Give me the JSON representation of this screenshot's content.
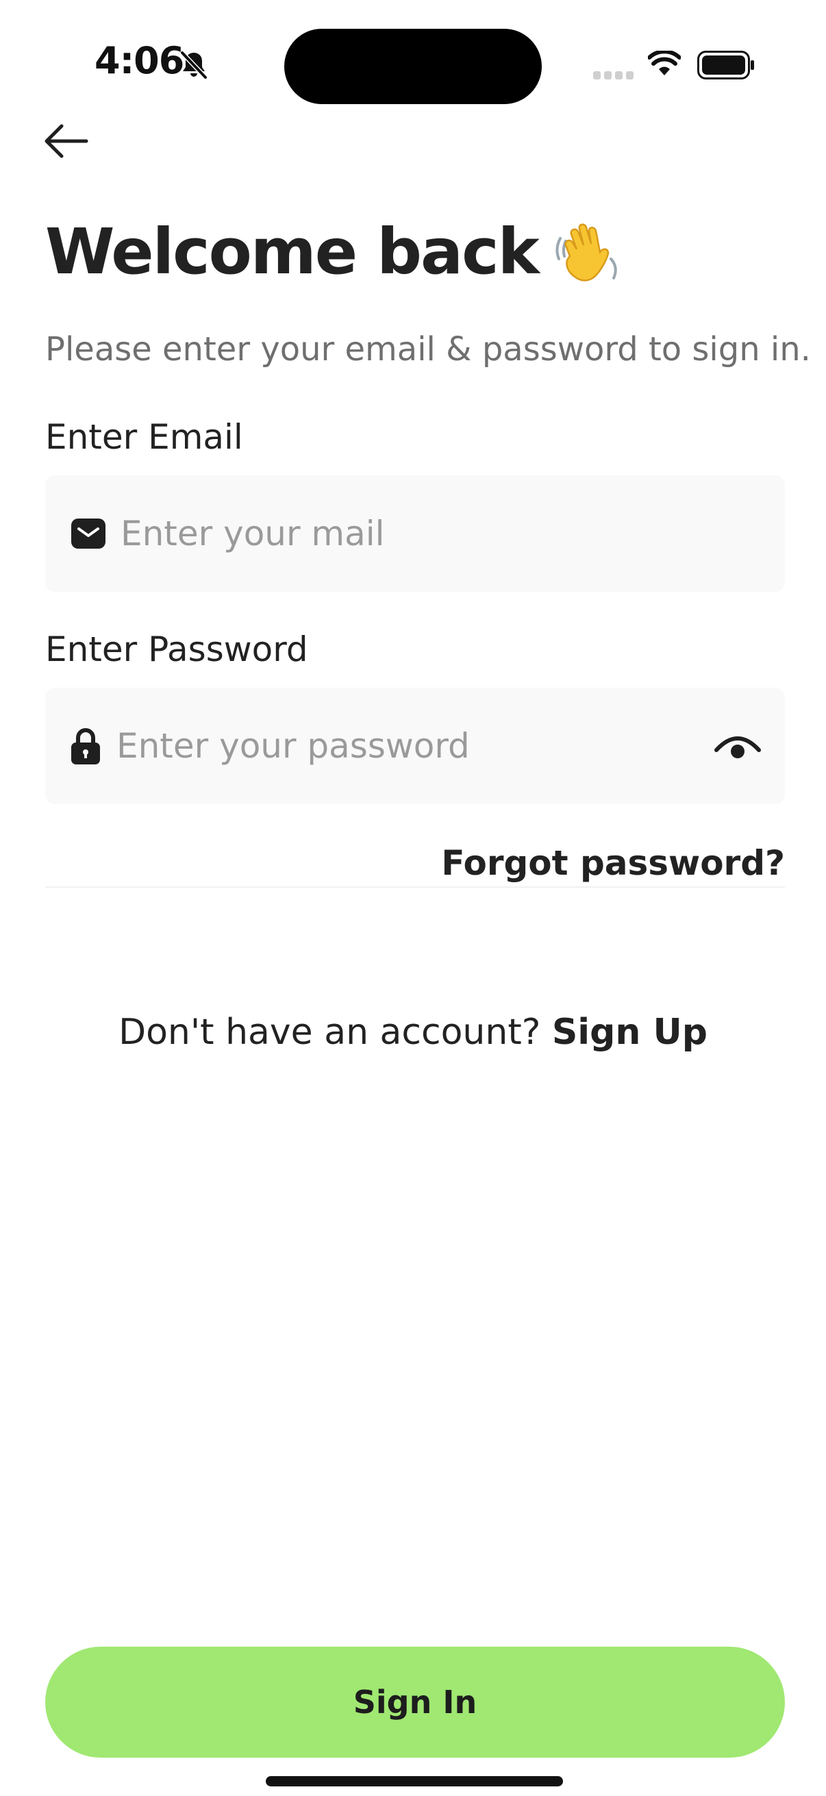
{
  "status_bar": {
    "time": "4:06",
    "icons": [
      "bell-slash-icon",
      "cellular-signal-icon",
      "wifi-icon",
      "battery-icon"
    ]
  },
  "header": {
    "back_icon": "arrow-left-icon"
  },
  "title": {
    "text": "Welcome back",
    "emoji_icon": "waving-hand-icon"
  },
  "subtitle": "Please enter your email & password to sign in.",
  "email": {
    "label": "Enter Email",
    "placeholder": "Enter your mail",
    "value": "",
    "icon": "envelope-icon"
  },
  "password": {
    "label": "Enter Password",
    "placeholder": "Enter your password",
    "value": "",
    "icon": "lock-icon",
    "toggle_icon": "eye-icon"
  },
  "forgot_password": "Forgot password?",
  "signup": {
    "prompt": "Don't have an account? ",
    "link": "Sign Up"
  },
  "sign_in_button": "Sign In",
  "colors": {
    "accent": "#a0e872",
    "text": "#222222",
    "muted": "#6f6f6f",
    "placeholder": "#9a9a9a",
    "input_bg": "#f9f9f9"
  }
}
